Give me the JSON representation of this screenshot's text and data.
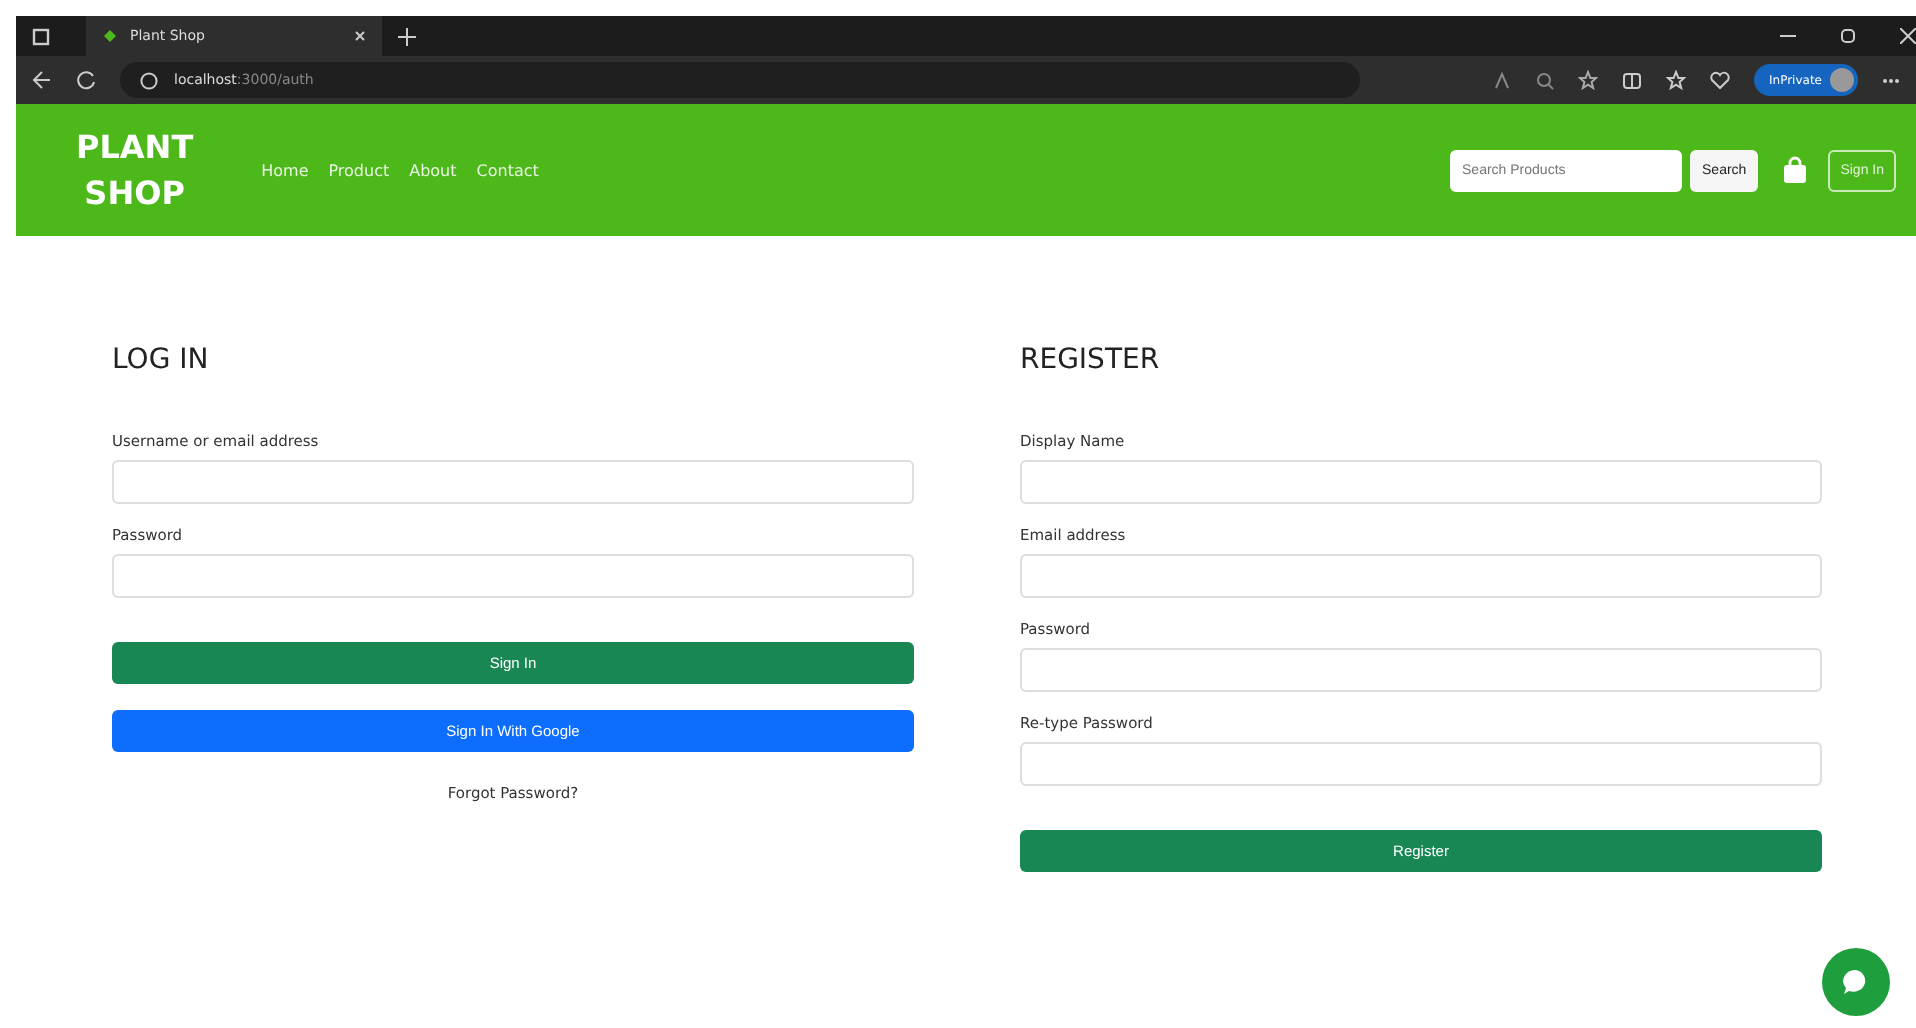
{
  "browser": {
    "tab_title": "Plant Shop",
    "url_host": "localhost",
    "url_path": ":3000/auth",
    "profile_label": "InPrivate"
  },
  "navbar": {
    "brand_lines": [
      "PLANT",
      "SHOP"
    ],
    "links": [
      "Home",
      "Product",
      "About",
      "Contact"
    ],
    "search": {
      "placeholder": "Search Products"
    },
    "search_button": "Search",
    "sign_in": "Sign In"
  },
  "login": {
    "title": "LOG IN",
    "fields": [
      {
        "label": "Username or email address"
      },
      {
        "label": "Password"
      }
    ],
    "buttons": [
      {
        "label": "Sign In",
        "kind": "primary"
      },
      {
        "label": "Sign In With Google",
        "kind": "google"
      }
    ],
    "forgot": "Forgot Password?"
  },
  "register": {
    "title": "REGISTER",
    "fields": [
      {
        "label": "Display Name"
      },
      {
        "label": "Email address"
      },
      {
        "label": "Password"
      },
      {
        "label": "Re-type Password"
      }
    ],
    "button": "Register"
  }
}
